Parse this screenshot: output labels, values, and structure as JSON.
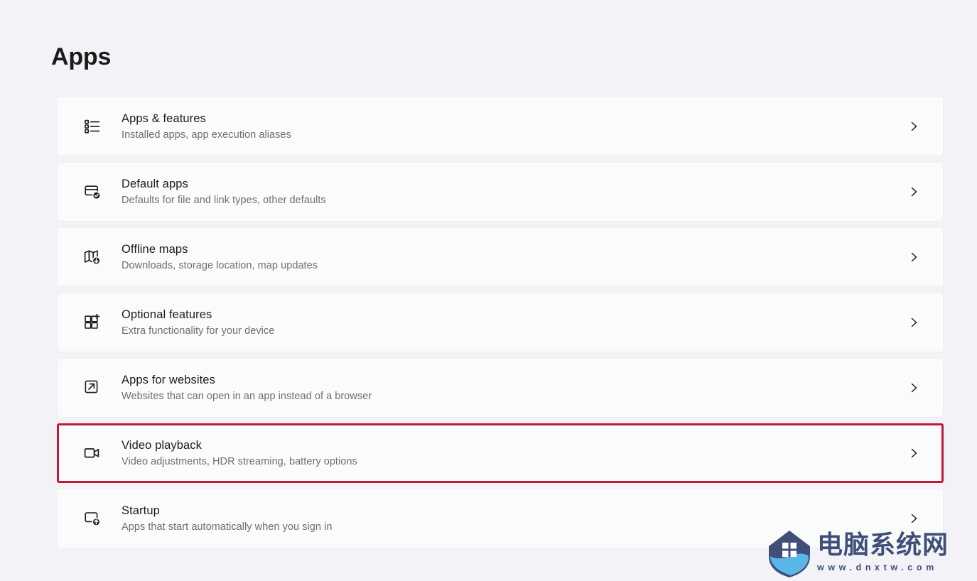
{
  "header": {
    "title": "Apps"
  },
  "colors": {
    "page_background": "#f3f3f7",
    "card_background": "#fafcfb",
    "card_border": "#eceff0",
    "title_text": "#1b1b1b",
    "subtitle_text": "#6e6e6e",
    "highlight_border": "#c2183c",
    "watermark": "#3f4f7a"
  },
  "settings_list": {
    "items": [
      {
        "title": "Apps & features",
        "subtitle": "Installed apps, app execution aliases",
        "icon": "list-bullets-icon",
        "highlighted": false
      },
      {
        "title": "Default apps",
        "subtitle": "Defaults for file and link types, other defaults",
        "icon": "window-check-icon",
        "highlighted": false
      },
      {
        "title": "Offline maps",
        "subtitle": "Downloads, storage location, map updates",
        "icon": "map-download-icon",
        "highlighted": false
      },
      {
        "title": "Optional features",
        "subtitle": "Extra functionality for your device",
        "icon": "grid-plus-icon",
        "highlighted": false
      },
      {
        "title": "Apps for websites",
        "subtitle": "Websites that can open in an app instead of a browser",
        "icon": "external-link-icon",
        "highlighted": false
      },
      {
        "title": "Video playback",
        "subtitle": "Video adjustments, HDR streaming, battery options",
        "icon": "video-camera-icon",
        "highlighted": true
      },
      {
        "title": "Startup",
        "subtitle": "Apps that start automatically when you sign in",
        "icon": "window-up-arrow-icon",
        "highlighted": false
      }
    ],
    "chevron_icon": "chevron-right-icon"
  },
  "watermark": {
    "logo_icon": "house-shield-logo",
    "brand": "电脑系统网",
    "url": "www.dnxtw.com"
  }
}
